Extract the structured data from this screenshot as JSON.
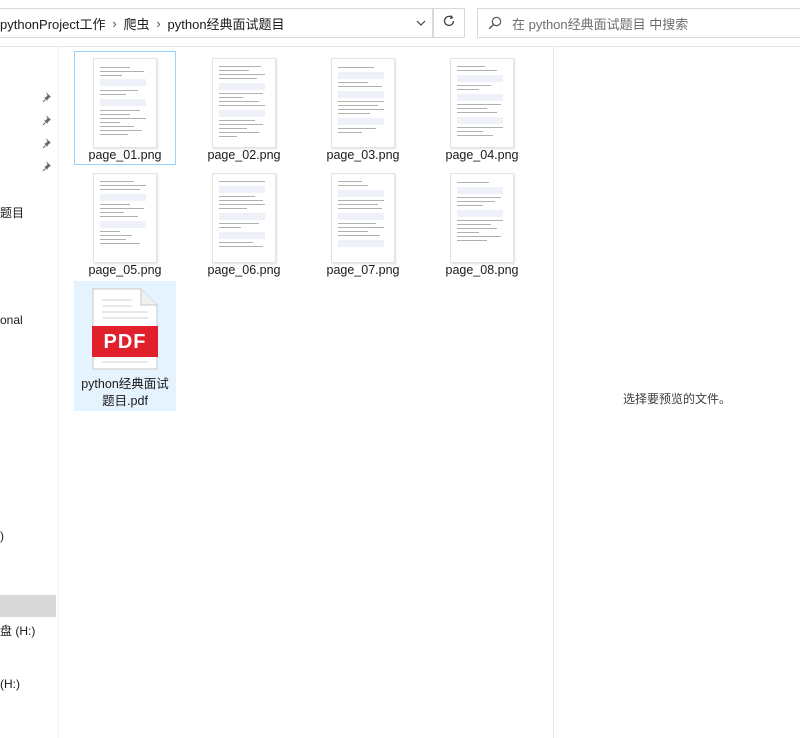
{
  "address": {
    "breadcrumbs": [
      "pythonProject工作",
      "爬虫",
      "python经典面试题目"
    ],
    "separator": "›",
    "dropdown_icon": "chevron-down-icon",
    "refresh_icon": "refresh-icon"
  },
  "search": {
    "placeholder": "在 python经典面试题目 中搜索",
    "icon": "search-icon"
  },
  "nav": {
    "pins": [
      "pin-icon",
      "pin-icon",
      "pin-icon",
      "pin-icon"
    ],
    "fragments": [
      "题目",
      "onal",
      ")",
      "盘 (H:)",
      "(H:)"
    ]
  },
  "files": [
    {
      "name": "page_01.png",
      "type": "png",
      "state": "focused"
    },
    {
      "name": "page_02.png",
      "type": "png",
      "state": ""
    },
    {
      "name": "page_03.png",
      "type": "png",
      "state": ""
    },
    {
      "name": "page_04.png",
      "type": "png",
      "state": ""
    },
    {
      "name": "page_05.png",
      "type": "png",
      "state": ""
    },
    {
      "name": "page_06.png",
      "type": "png",
      "state": ""
    },
    {
      "name": "page_07.png",
      "type": "png",
      "state": ""
    },
    {
      "name": "page_08.png",
      "type": "png",
      "state": ""
    },
    {
      "name": "python经典面试题目.pdf",
      "type": "pdf",
      "state": "selected",
      "badge": "PDF"
    }
  ],
  "preview": {
    "message": "选择要预览的文件。"
  },
  "colors": {
    "pdf_badge": "#e0202b",
    "selection": "#e5f3ff",
    "focus_border": "#99d1ff"
  }
}
